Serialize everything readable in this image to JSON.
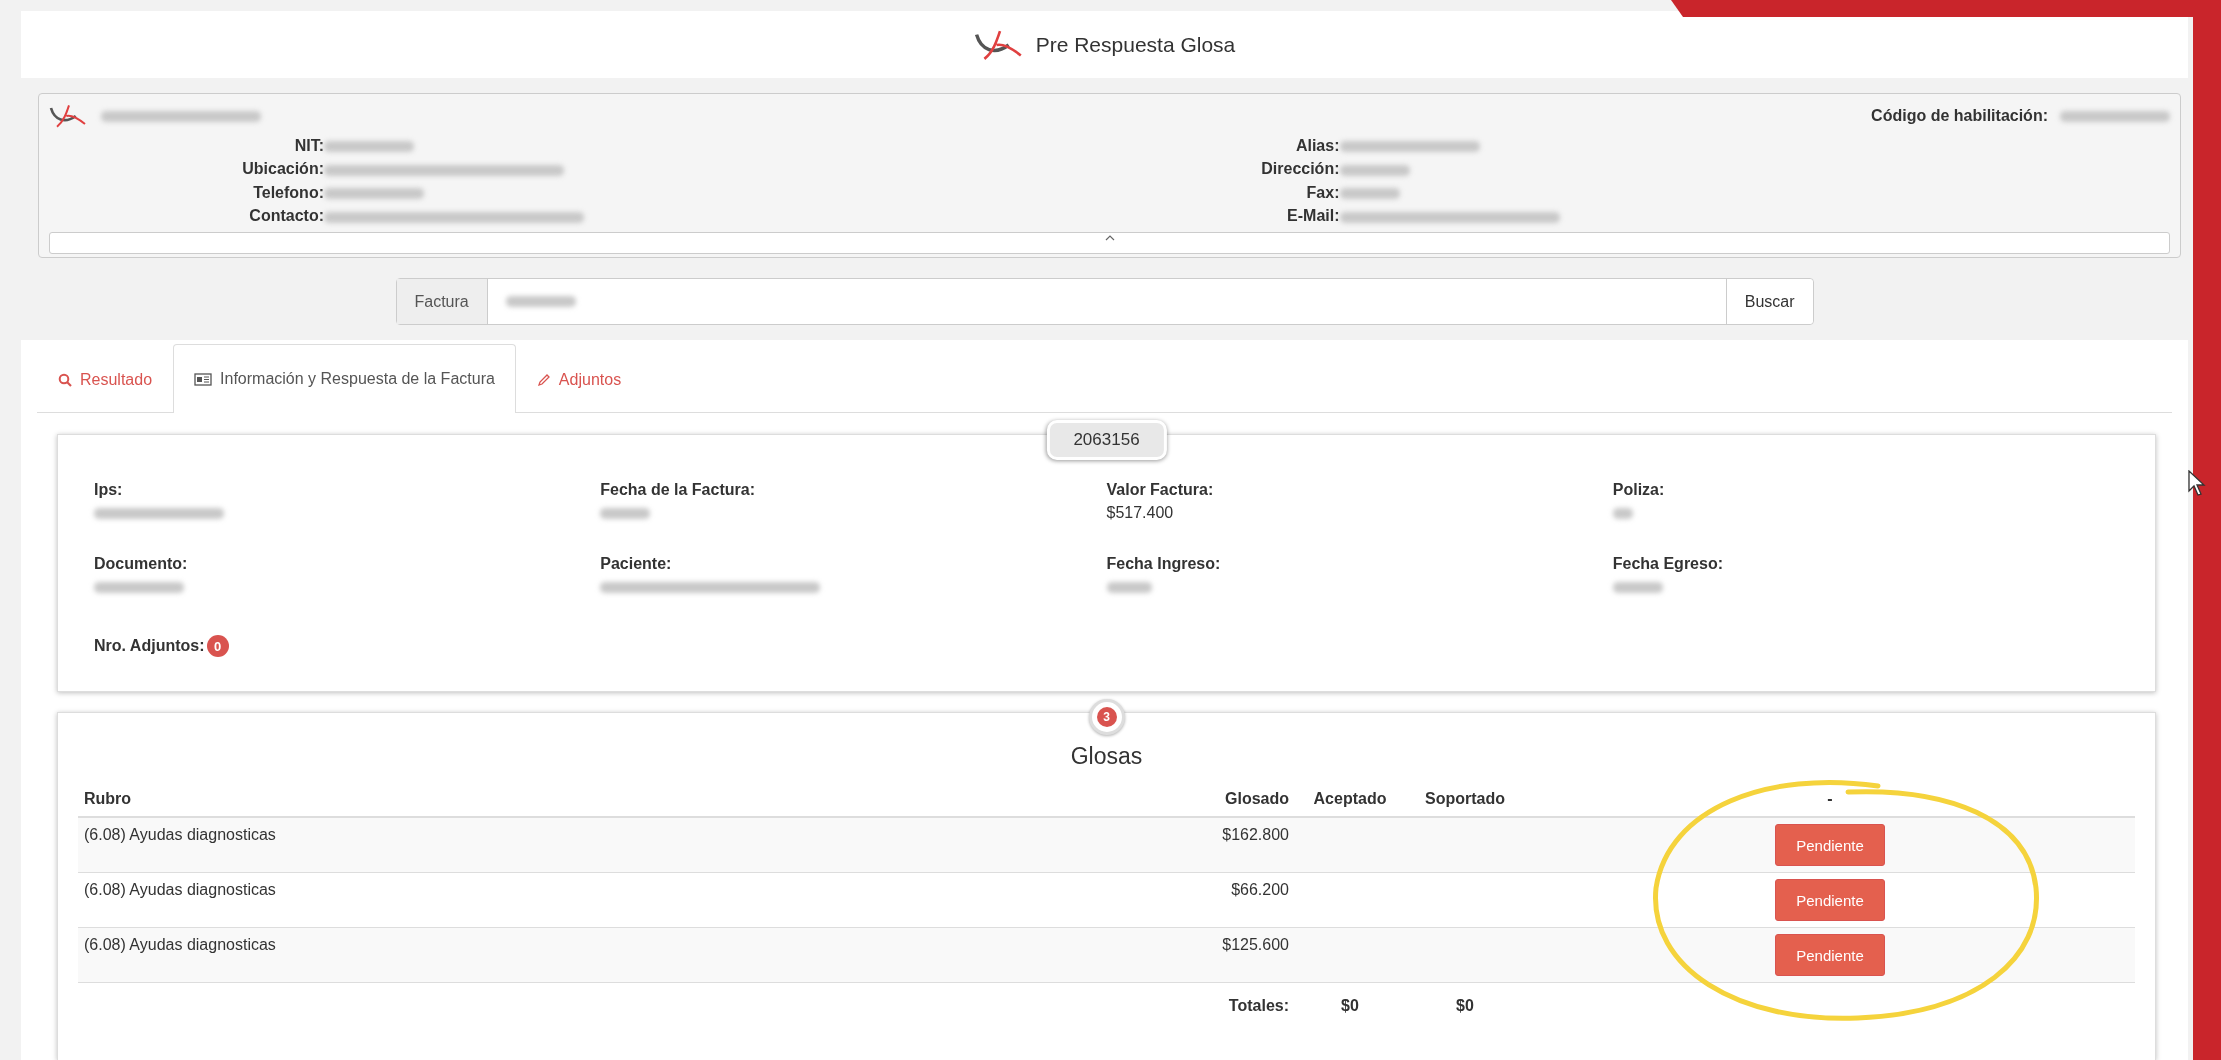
{
  "header": {
    "title": "Pre Respuesta Glosa"
  },
  "company": {
    "code_label": "Código de habilitación:",
    "fields_left": [
      {
        "label": "NIT:"
      },
      {
        "label": "Ubicación:"
      },
      {
        "label": "Telefono:"
      },
      {
        "label": "Contacto:"
      }
    ],
    "fields_right": [
      {
        "label": "Alias:"
      },
      {
        "label": "Dirección:"
      },
      {
        "label": "Fax:"
      },
      {
        "label": "E-Mail:"
      }
    ]
  },
  "search": {
    "label": "Factura",
    "button": "Buscar"
  },
  "tabs": [
    {
      "label": "Resultado",
      "selected": false
    },
    {
      "label": "Información y Respuesta de la Factura",
      "selected": true
    },
    {
      "label": "Adjuntos",
      "selected": false
    }
  ],
  "invoice": {
    "number": "2063156",
    "fields": [
      {
        "label": "Ips:"
      },
      {
        "label": "Fecha de la Factura:"
      },
      {
        "label": "Valor Factura:",
        "value": "$517.400"
      },
      {
        "label": "Poliza:"
      },
      {
        "label": "Documento:"
      },
      {
        "label": "Paciente:"
      },
      {
        "label": "Fecha Ingreso:"
      },
      {
        "label": "Fecha Egreso:"
      }
    ],
    "attachments_label": "Nro. Adjuntos:",
    "attachments_count": "0"
  },
  "glosas": {
    "count": "3",
    "title": "Glosas",
    "columns": [
      "Rubro",
      "Glosado",
      "Aceptado",
      "Soportado",
      "-"
    ],
    "rows": [
      {
        "rubro": "(6.08) Ayudas diagnosticas",
        "glosado": "$162.800",
        "status": "Pendiente"
      },
      {
        "rubro": "(6.08) Ayudas diagnosticas",
        "glosado": "$66.200",
        "status": "Pendiente"
      },
      {
        "rubro": "(6.08) Ayudas diagnosticas",
        "glosado": "$125.600",
        "status": "Pendiente"
      }
    ],
    "totals": {
      "label": "Totales:",
      "aceptado": "$0",
      "soportado": "$0"
    }
  }
}
